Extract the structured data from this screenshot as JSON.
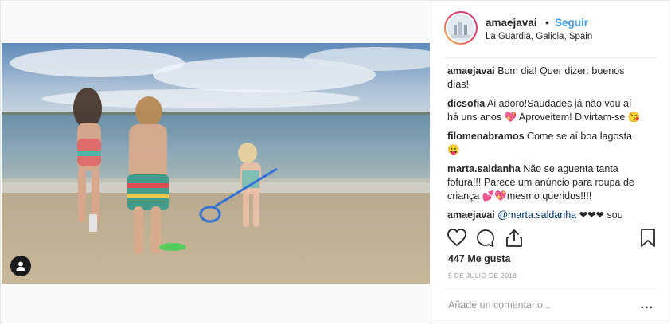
{
  "post": {
    "username": "amaejavai",
    "separator": "•",
    "follow_label": "Seguir",
    "location": "La Guardia, Galicia, Spain",
    "likes": "447 Me gusta",
    "date": "5 DE JULIO DE 2018",
    "add_comment_placeholder": "Añade un comentario...",
    "more_label": "..."
  },
  "comments": [
    {
      "user": "amaejavai",
      "text": "Bom dia! Quer dizer: buenos días!",
      "has_like": false
    },
    {
      "user": "dicsofia",
      "text": "Ai adoro!Saudades já não vou aí há uns anos 💖 Aproveitem! Divirtam-se 😘",
      "has_like": true
    },
    {
      "user": "filomenabramos",
      "text": "Come se aí boa lagosta 😛",
      "has_like": true
    },
    {
      "user": "marta.saldanha",
      "text": "Não se aguenta tanta fofura!!! Parece um anúncio para roupa de criança 💕💖mesmo queridos!!!!",
      "has_like": true
    },
    {
      "user": "amaejavai",
      "mention": "@marta.saldanha",
      "text": " ❤❤❤ sou",
      "has_like": true
    }
  ],
  "icons": {
    "like": "heart-icon",
    "comment": "comment-icon",
    "share": "share-icon",
    "save": "bookmark-icon",
    "tag": "user-tag-icon",
    "comment_like": "heart-small-icon"
  },
  "colors": {
    "link": "#3897f0",
    "text": "#262626",
    "muted": "#999999",
    "mention": "#003569"
  }
}
